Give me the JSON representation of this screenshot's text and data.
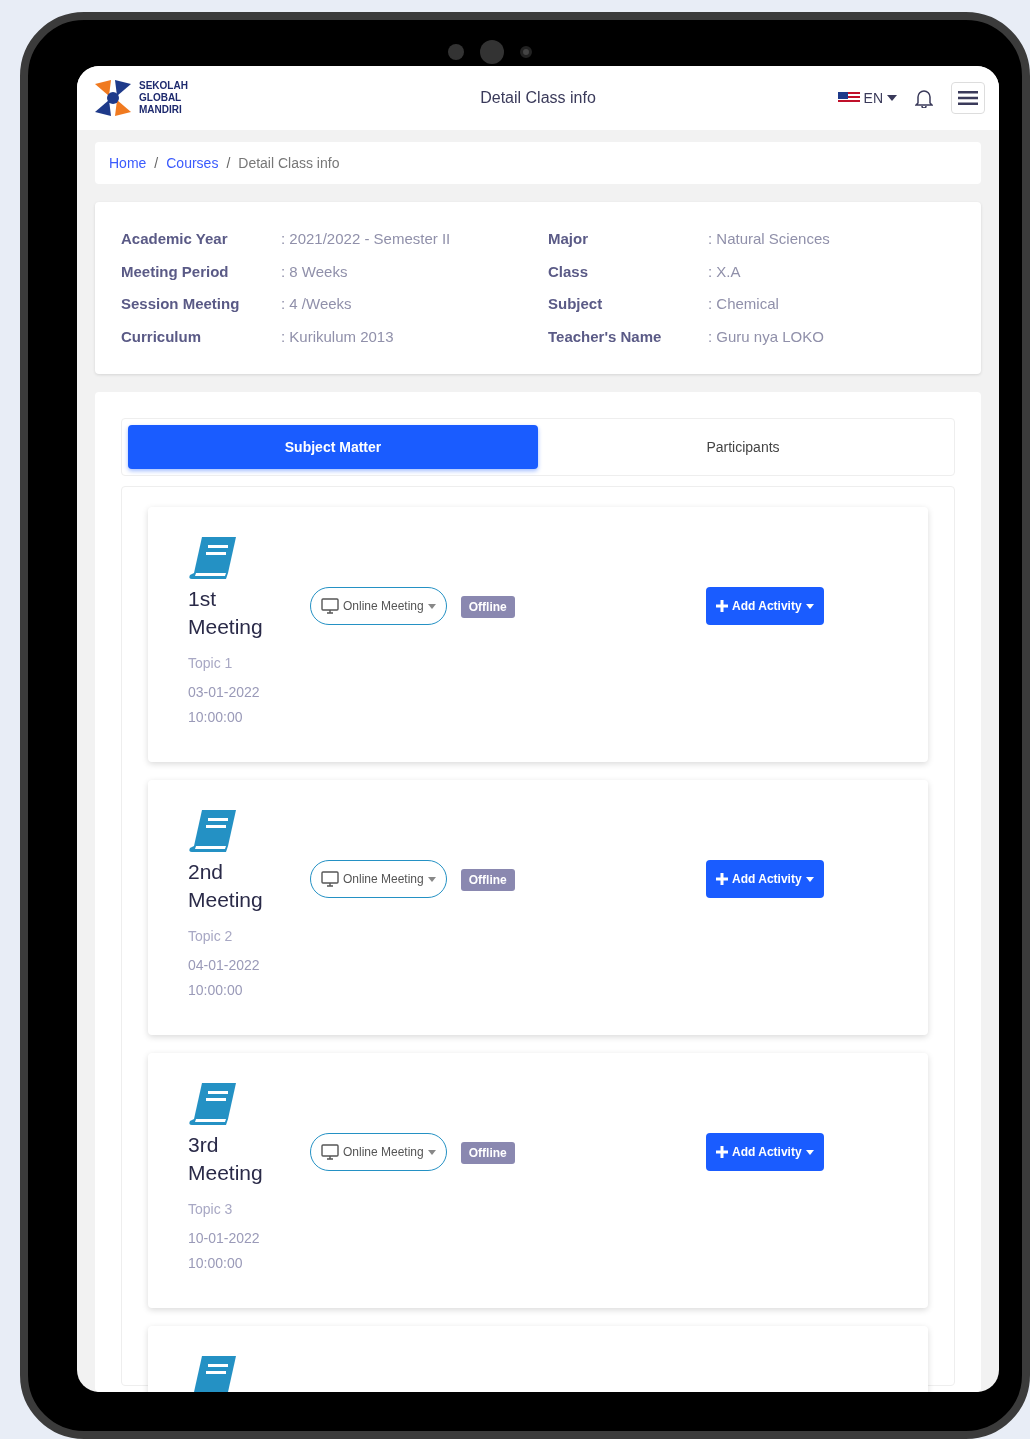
{
  "header": {
    "logo_text": "SEKOLAH GLOBAL MANDIRI",
    "title": "Detail Class info",
    "language": "EN"
  },
  "breadcrumb": [
    {
      "label": "Home",
      "link": true
    },
    {
      "separator": "/",
      "label": "Courses",
      "link": true
    },
    {
      "separator": "/",
      "label": "Detail Class info",
      "link": false
    }
  ],
  "class_info": {
    "left": [
      {
        "label": "Academic Year",
        "value": ": 2021/2022 - Semester II"
      },
      {
        "label": "Meeting Period",
        "value": ": 8 Weeks"
      },
      {
        "label": "Session Meeting",
        "value": ": 4 /Weeks"
      },
      {
        "label": "Curriculum",
        "value": ": Kurikulum 2013"
      }
    ],
    "right": [
      {
        "label": "Major",
        "value": ": Natural Sciences"
      },
      {
        "label": "Class",
        "value": ": X.A"
      },
      {
        "label": "Subject",
        "value": ": Chemical"
      },
      {
        "label": "Teacher's Name",
        "value": ": Guru nya LOKO"
      }
    ]
  },
  "tabs": [
    {
      "label": "Subject Matter",
      "selected": true
    },
    {
      "label": "Participants",
      "selected": false
    }
  ],
  "meetings": [
    {
      "title": "1st Meeting",
      "topic": "Topic 1",
      "date": "03-01-2022",
      "time": "10:00:00",
      "mode": "Online Meeting",
      "status": "Offline",
      "action": "Add Activity"
    },
    {
      "title": "2nd Meeting",
      "topic": "Topic 2",
      "date": "04-01-2022",
      "time": "10:00:00",
      "mode": "Online Meeting",
      "status": "Offline",
      "action": "Add Activity"
    },
    {
      "title": "3rd Meeting",
      "topic": "Topic 3",
      "date": "10-01-2022",
      "time": "10:00:00",
      "mode": "Online Meeting",
      "status": "Offline",
      "action": "Add Activity"
    }
  ]
}
